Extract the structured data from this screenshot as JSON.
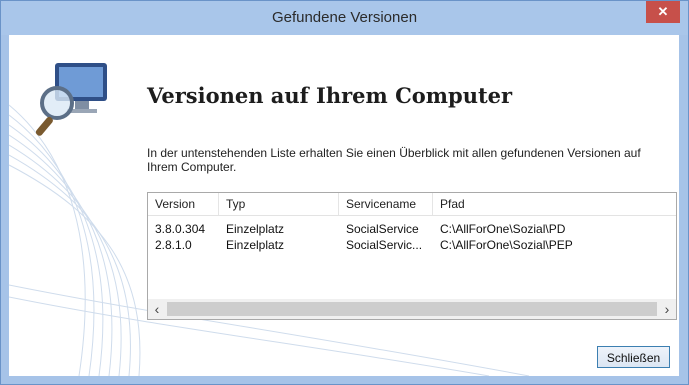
{
  "window": {
    "title": "Gefundene Versionen",
    "close_glyph": "✕"
  },
  "content": {
    "heading": "Versionen auf Ihrem Computer",
    "description": "In der untenstehenden Liste erhalten Sie einen Überblick mit allen gefundenen Versionen auf Ihrem Computer."
  },
  "list": {
    "columns": [
      "Version",
      "Typ",
      "Servicename",
      "Pfad"
    ],
    "rows": [
      [
        "3.8.0.304",
        "Einzelplatz",
        "SocialService",
        "C:\\AllForOne\\Sozial\\PD"
      ],
      [
        "2.8.1.0",
        "Einzelplatz",
        "SocialServic...",
        "C:\\AllForOne\\Sozial\\PEP"
      ]
    ],
    "scroll_left": "‹",
    "scroll_right": "›"
  },
  "buttons": {
    "close_label": "Schließen"
  },
  "icons": {
    "logo": "monitor-magnifier-icon"
  },
  "colors": {
    "titlebar": "#a9c6ea",
    "close": "#c7504a",
    "accent": "#3c7fb1"
  }
}
